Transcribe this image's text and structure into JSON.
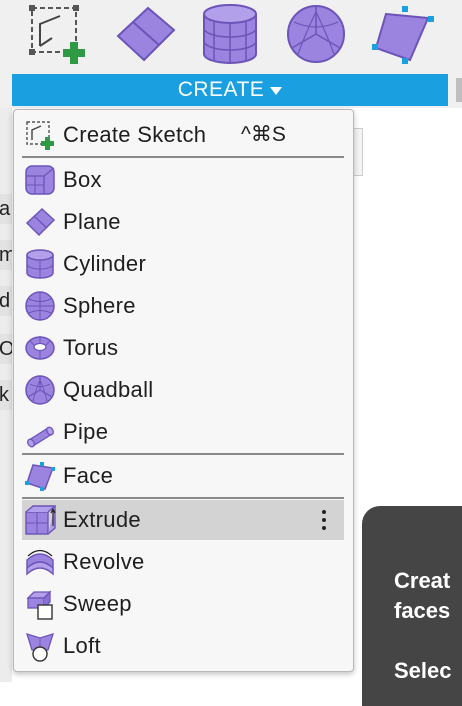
{
  "toolbar": {
    "icons": [
      "create-sketch-icon",
      "plane-icon",
      "cylinder-icon",
      "sphere-icon",
      "face-icon"
    ],
    "create_label": "CREATE",
    "colors": {
      "accent": "#1a9fe0",
      "shape_fill": "#9b84e0",
      "shape_stroke": "#6c54b8",
      "plus": "#2e9a44"
    }
  },
  "background": {
    "left_fragments": [
      "a",
      "m",
      "d",
      "Or",
      "k"
    ],
    "tooltip": {
      "line1": "Creat",
      "line2": "faces",
      "line3": "Selec"
    }
  },
  "menu": {
    "sketch": {
      "label": "Create Sketch",
      "shortcut": "^⌘S"
    },
    "primitives": [
      {
        "label": "Box",
        "icon": "box-icon"
      },
      {
        "label": "Plane",
        "icon": "plane-icon"
      },
      {
        "label": "Cylinder",
        "icon": "cylinder-icon"
      },
      {
        "label": "Sphere",
        "icon": "sphere-icon"
      },
      {
        "label": "Torus",
        "icon": "torus-icon"
      },
      {
        "label": "Quadball",
        "icon": "quadball-icon"
      },
      {
        "label": "Pipe",
        "icon": "pipe-icon"
      }
    ],
    "face": {
      "label": "Face",
      "icon": "face-icon"
    },
    "features": [
      {
        "label": "Extrude",
        "icon": "extrude-icon",
        "highlighted": true
      },
      {
        "label": "Revolve",
        "icon": "revolve-icon"
      },
      {
        "label": "Sweep",
        "icon": "sweep-icon"
      },
      {
        "label": "Loft",
        "icon": "loft-icon"
      }
    ]
  }
}
